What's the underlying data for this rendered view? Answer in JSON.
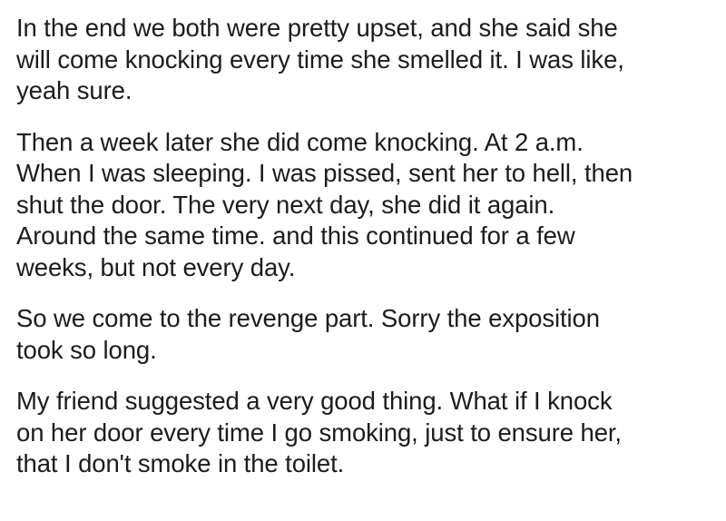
{
  "post": {
    "paragraphs": [
      "In the end we both were pretty upset, and she said she\nwill come knocking every time she smelled it. I was like,\nyeah sure.",
      "Then a week later she did come knocking. At 2 a.m.\nWhen I was sleeping. I was pissed, sent her to hell, then\nshut the door. The very next day, she did it again.\nAround the same time. and this continued for a few\nweeks, but not every day.",
      "So we come to the revenge part. Sorry the exposition\ntook so long.",
      "My friend suggested a very good thing. What if I knock\non her door every time I go smoking, just to ensure her,\nthat I don't smoke in the toilet."
    ]
  }
}
